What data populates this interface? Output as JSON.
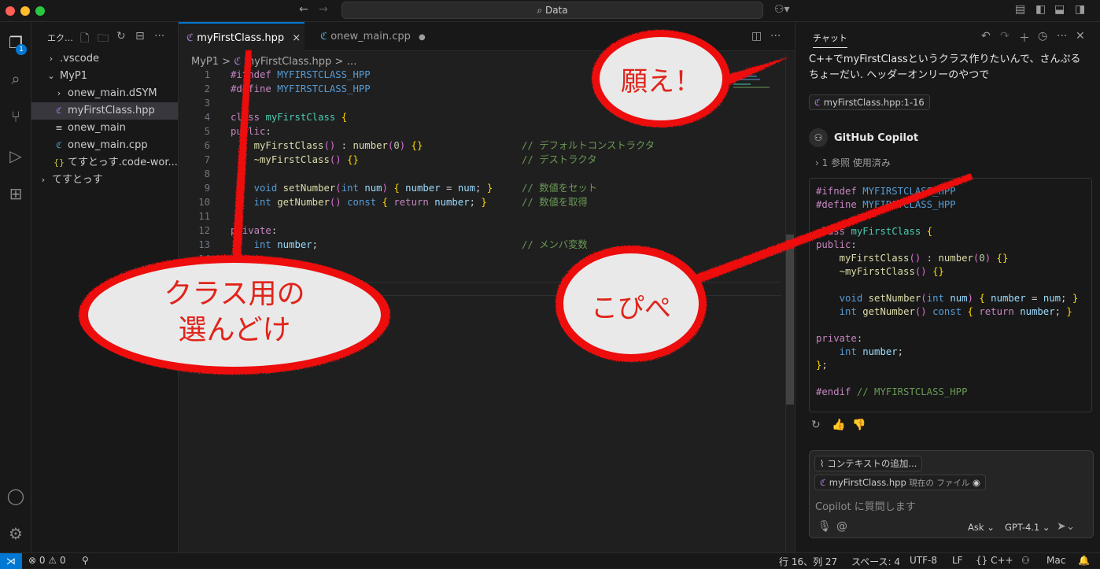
{
  "titlebar": {
    "search_text": "Data",
    "search_icon": "search-icon"
  },
  "activity": {
    "explorer_badge": "1"
  },
  "sidebar": {
    "header": "エク…",
    "items": [
      {
        "label": ".vscode",
        "indent": 1,
        "icon": "chevron-right-icon"
      },
      {
        "label": "MyP1",
        "indent": 1,
        "icon": "chevron-down-icon"
      },
      {
        "label": "onew_main.dSYM",
        "indent": 2,
        "icon": "chevron-right-icon"
      },
      {
        "label": "myFirstClass.hpp",
        "indent": 2,
        "icon": "cpp-header-icon",
        "selected": true
      },
      {
        "label": "onew_main",
        "indent": 2,
        "icon": "file-lines-icon"
      },
      {
        "label": "onew_main.cpp",
        "indent": 2,
        "icon": "cpp-icon"
      },
      {
        "label": "てすとっす.code-wor...",
        "indent": 2,
        "icon": "json-braces-icon"
      },
      {
        "label": "てすとっす",
        "indent": 0,
        "icon": "chevron-right-icon"
      }
    ]
  },
  "editor": {
    "tabs": [
      {
        "label": "myFirstClass.hpp",
        "active": true,
        "close": "×"
      },
      {
        "label": "onew_main.cpp",
        "active": false,
        "dirty": "●"
      }
    ],
    "breadcrumb": [
      "MyP1",
      ">",
      "myFirstClass.hpp",
      ">",
      "…"
    ],
    "lines": [
      {
        "n": "1",
        "code": "#ifndef MYFIRSTCLASS_HPP"
      },
      {
        "n": "2",
        "code": "#define MYFIRSTCLASS_HPP"
      },
      {
        "n": "3",
        "code": ""
      },
      {
        "n": "4",
        "code": "class myFirstClass {"
      },
      {
        "n": "5",
        "code": "public:"
      },
      {
        "n": "6",
        "code": "    myFirstClass() : number(0) {}",
        "comment": "// デフォルトコンストラクタ"
      },
      {
        "n": "7",
        "code": "    ~myFirstClass() {}",
        "comment": "// デストラクタ"
      },
      {
        "n": "8",
        "code": ""
      },
      {
        "n": "9",
        "code": "    void setNumber(int num) { number = num; }",
        "comment": "// 数値をセット"
      },
      {
        "n": "10",
        "code": "    int getNumber() const { return number; }",
        "comment": "// 数値を取得"
      },
      {
        "n": "11",
        "code": ""
      },
      {
        "n": "12",
        "code": "private:"
      },
      {
        "n": "13",
        "code": "    int number;",
        "comment": "// メンバ変数"
      },
      {
        "n": "14",
        "code": ""
      }
    ]
  },
  "chat": {
    "tab_label": "チャット",
    "user_message": "C++でmyFirstClassというクラス作りたいんで、さんぷるちょーだい. ヘッダーオンリーのやつで",
    "reference_pill": "myFirstClass.hpp:1-16",
    "assistant_name": "GitHub Copilot",
    "references_used": "1 参照 使用済み",
    "code_lines": [
      "#ifndef MYFIRSTCLASS_HPP",
      "#define MYFIRSTCLASS_HPP",
      "",
      "class myFirstClass {",
      "public:",
      "    myFirstClass() : number(0) {}",
      "    ~myFirstClass() {}",
      "",
      "    void setNumber(int num) { number = num; }",
      "    int getNumber() const { return number; }",
      "",
      "private:",
      "    int number;",
      "};",
      "",
      "#endif // MYFIRSTCLASS_HPP"
    ],
    "add_context": "コンテキストの追加...",
    "current_file_name": "myFirstClass.hpp",
    "current_file_suffix": "現在の ファイル",
    "input_placeholder": "Copilot に質問します",
    "mode": "Ask",
    "model": "GPT-4.1"
  },
  "status": {
    "errors": "0",
    "warnings": "0",
    "position": "行 16、列 27",
    "spaces": "スペース: 4",
    "encoding": "UTF-8",
    "eol": "LF",
    "language": "C++",
    "platform": "Mac"
  },
  "annotations": {
    "bubble_pray": "願え！",
    "bubble_select_line1": "クラス用の",
    "bubble_select_line2": "選んどけ",
    "bubble_copy": "こぴぺ",
    "color_red": "#ee1111"
  }
}
